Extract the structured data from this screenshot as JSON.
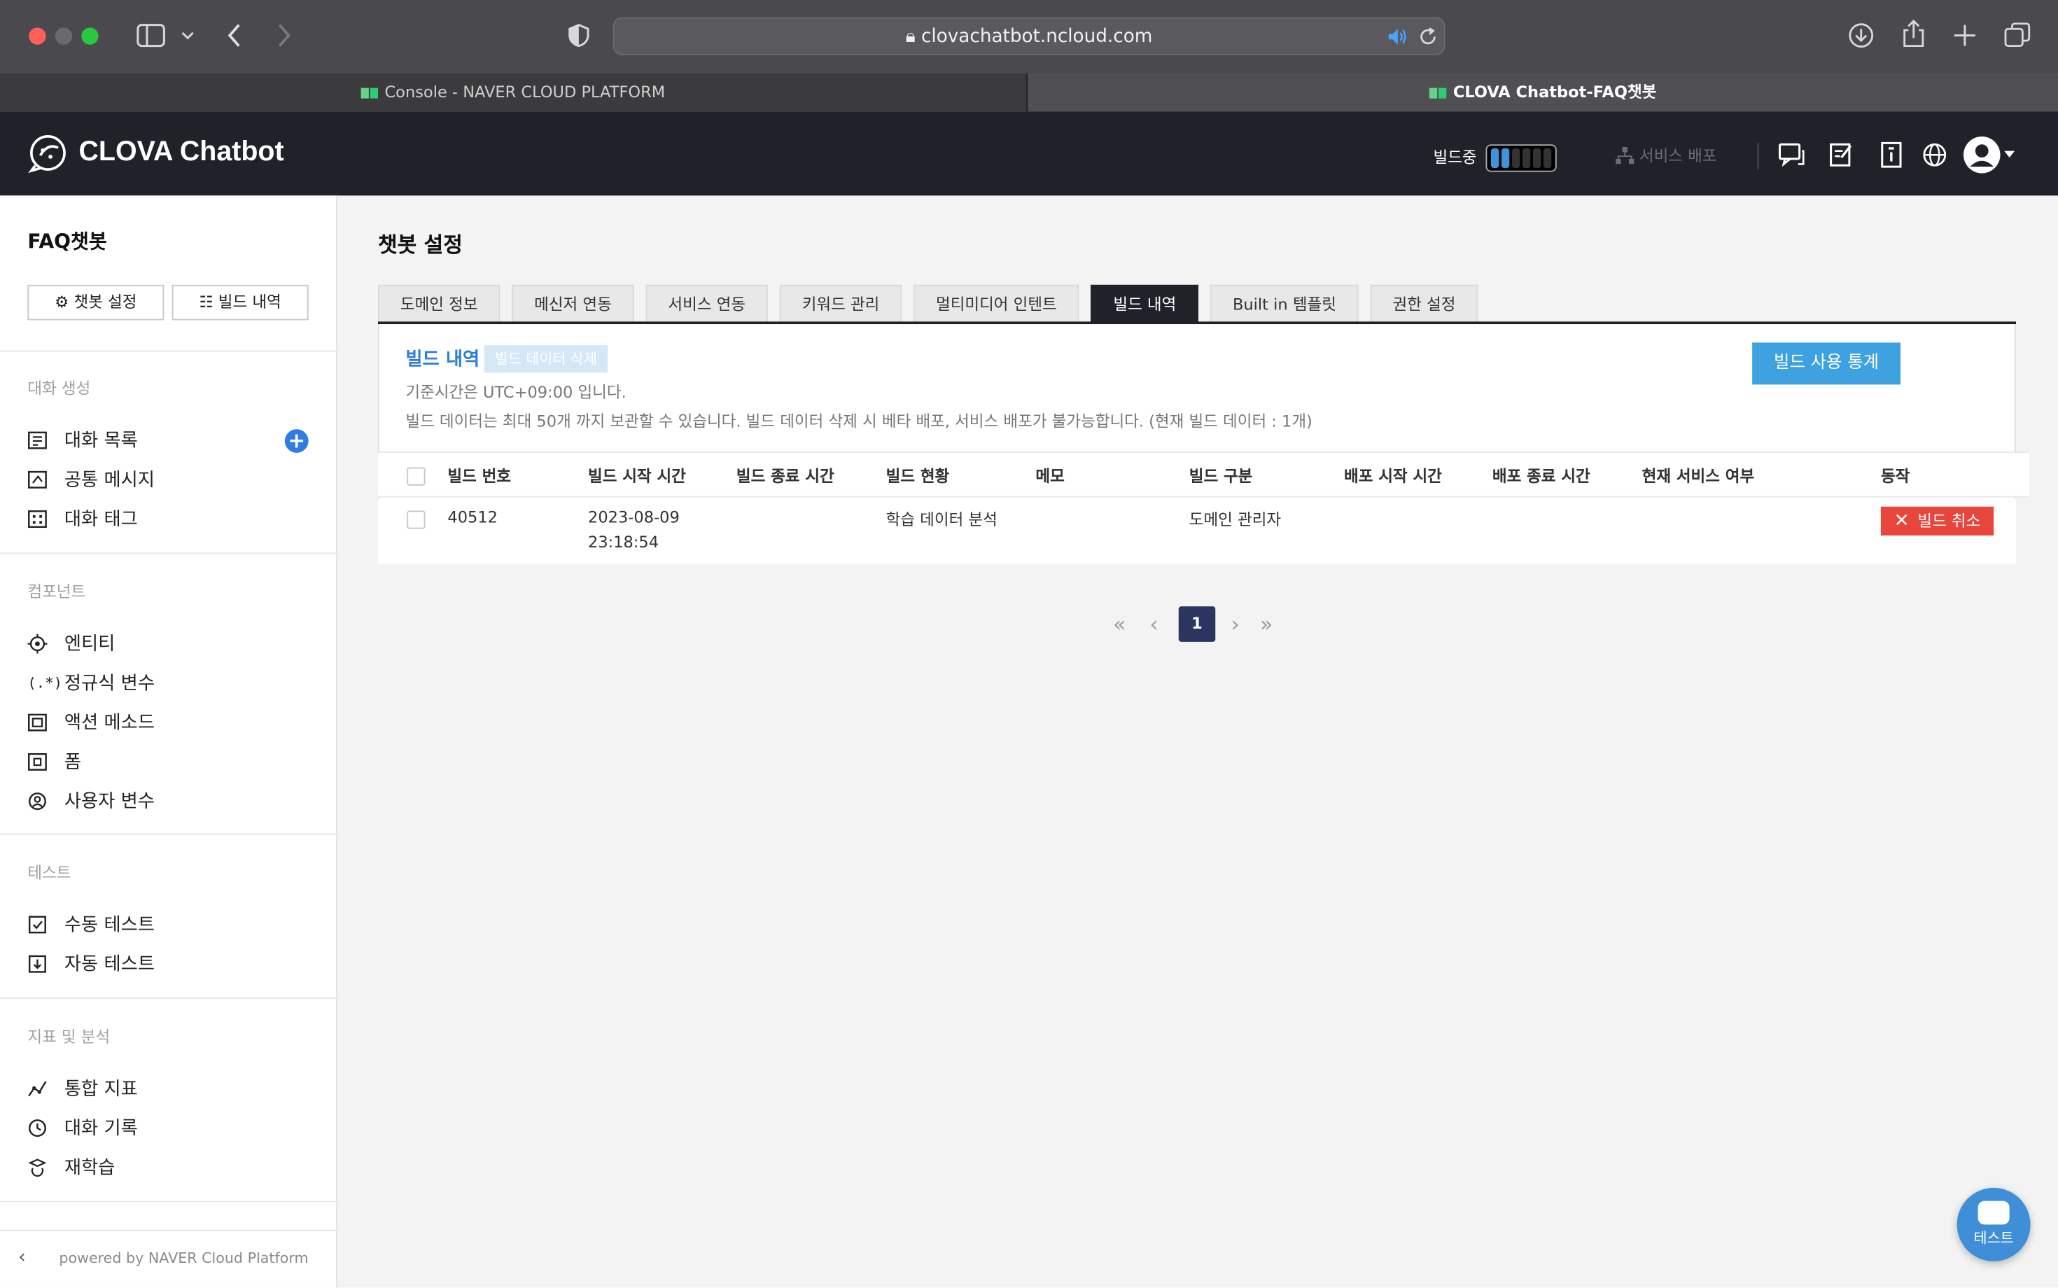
{
  "browser": {
    "url": "clovachatbot.ncloud.com",
    "tabs": [
      {
        "label": "Console - NAVER CLOUD PLATFORM",
        "active": false
      },
      {
        "label": "CLOVA Chatbot-FAQ챗봇",
        "active": true
      }
    ]
  },
  "header": {
    "logo": "CLOVA Chatbot",
    "build_status_label": "빌드중",
    "build_progress_segments_on": 2,
    "build_progress_segments_total": 6,
    "deploy_label": "서비스 배포"
  },
  "sidebar": {
    "bot_name": "FAQ챗봇",
    "buttons": {
      "settings": "챗봇 설정",
      "build_history": "빌드 내역"
    },
    "sections": [
      {
        "title": "대화 생성",
        "items": [
          "대화 목록",
          "공통 메시지",
          "대화 태그"
        ]
      },
      {
        "title": "컴포넌트",
        "items": [
          "엔티티",
          "정규식 변수",
          "액션 메소드",
          "폼",
          "사용자 변수"
        ]
      },
      {
        "title": "테스트",
        "items": [
          "수동 테스트",
          "자동 테스트"
        ]
      },
      {
        "title": "지표 및 분석",
        "items": [
          "통합 지표",
          "대화 기록",
          "재학습"
        ]
      }
    ],
    "footer": "powered by NAVER Cloud Platform"
  },
  "main": {
    "page_title": "챗봇 설정",
    "tabs": [
      "도메인 정보",
      "메신저 연동",
      "서비스 연동",
      "키워드 관리",
      "멀티미디어 인텐트",
      "빌드 내역",
      "Built in 템플릿",
      "권한 설정"
    ],
    "active_tab": "빌드 내역",
    "panel": {
      "title": "빌드 내역",
      "delete_button": "빌드 데이터 삭제",
      "note_timezone": "기준시간은 UTC+09:00 입니다.",
      "note_limit": "빌드 데이터는 최대 50개 까지 보관할 수 있습니다. 빌드 데이터 삭제 시 베타 배포, 서비스 배포가 불가능합니다. (현재 빌드 데이터 : 1개)",
      "stats_button": "빌드 사용 통계"
    },
    "table": {
      "columns": [
        "빌드 번호",
        "빌드 시작 시간",
        "빌드 종료 시간",
        "빌드 현황",
        "메모",
        "빌드 구분",
        "배포 시작 시간",
        "배포 종료 시간",
        "현재 서비스 여부",
        "동작"
      ],
      "rows": [
        {
          "build_no": "40512",
          "start_date": "2023-08-09",
          "start_time": "23:18:54",
          "end_time": "",
          "status": "학습 데이터 분석",
          "memo": "",
          "type": "도메인 관리자",
          "deploy_start": "",
          "deploy_end": "",
          "in_service": "",
          "action": "빌드 취소"
        }
      ]
    },
    "pagination": {
      "current": "1"
    }
  },
  "chat_widget": {
    "label": "테스트"
  },
  "colors": {
    "accent": "#3ea2e0",
    "header_bg": "#1f2229",
    "danger": "#e8453c",
    "pager_active": "#2b3560"
  }
}
